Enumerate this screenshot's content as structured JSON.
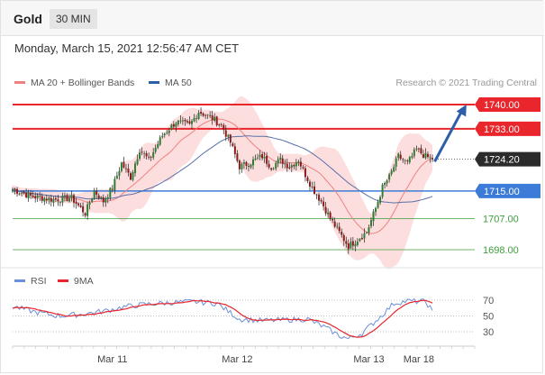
{
  "header": {
    "title": "Gold",
    "timeframe": "30 MIN"
  },
  "datetime": "Monday, March 15, 2021 12:56:47 AM CET",
  "colors": {
    "resistance": "#e8262b",
    "support": "#3d7bd8",
    "target": "#3e9e3e",
    "price_tag": "#2b2b2b",
    "ma20": "#f08080",
    "bollinger": "#fbd3d3",
    "ma50": "#5a6fa8",
    "up_candle": "#2e7d32",
    "down_candle": "#8b1a1a",
    "rsi": "#6b8fd8",
    "rsi_ma": "#e8262b",
    "arrow": "#2d5fa8"
  },
  "chart_data": [
    {
      "type": "candlestick",
      "legend": [
        {
          "name": "MA 20 + Bollinger Bands",
          "color": "#f08080"
        },
        {
          "name": "MA 50",
          "color": "#2d5fa8"
        }
      ],
      "credit": "Research © 2021 Trading Central",
      "x_ticks": [
        {
          "label": "Mar 11",
          "index": 44
        },
        {
          "label": "Mar 12",
          "index": 99
        },
        {
          "label": "Mar 13",
          "index": 157
        },
        {
          "label": "Mar 18",
          "index": 179
        }
      ],
      "ylim": [
        1690,
        1748
      ],
      "levels": [
        {
          "value": 1740.0,
          "label": "1740.00",
          "kind": "resistance"
        },
        {
          "value": 1733.0,
          "label": "1733.00",
          "kind": "resistance"
        },
        {
          "value": 1724.2,
          "label": "1724.20",
          "kind": "current"
        },
        {
          "value": 1715.0,
          "label": "1715.00",
          "kind": "support"
        },
        {
          "value": 1707.0,
          "label": "1707.00",
          "kind": "target"
        },
        {
          "value": 1698.0,
          "label": "1698.00",
          "kind": "target"
        }
      ],
      "close_anchors": [
        [
          0,
          1715.5
        ],
        [
          8,
          1713.5
        ],
        [
          18,
          1712.5
        ],
        [
          26,
          1713
        ],
        [
          32,
          1708.5
        ],
        [
          36,
          1715
        ],
        [
          40,
          1712
        ],
        [
          44,
          1716
        ],
        [
          48,
          1723
        ],
        [
          52,
          1719
        ],
        [
          56,
          1727
        ],
        [
          60,
          1724
        ],
        [
          66,
          1731
        ],
        [
          72,
          1735
        ],
        [
          78,
          1734
        ],
        [
          82,
          1738
        ],
        [
          88,
          1736
        ],
        [
          92,
          1734
        ],
        [
          96,
          1729
        ],
        [
          100,
          1722
        ],
        [
          104,
          1723
        ],
        [
          110,
          1725
        ],
        [
          114,
          1722
        ],
        [
          118,
          1724
        ],
        [
          122,
          1722
        ],
        [
          126,
          1724
        ],
        [
          128,
          1721
        ],
        [
          132,
          1716
        ],
        [
          136,
          1712
        ],
        [
          140,
          1707
        ],
        [
          144,
          1703
        ],
        [
          148,
          1699
        ],
        [
          152,
          1701
        ],
        [
          156,
          1703
        ],
        [
          160,
          1710
        ],
        [
          163,
          1716
        ],
        [
          166,
          1719
        ],
        [
          170,
          1725
        ],
        [
          174,
          1723
        ],
        [
          178,
          1727
        ],
        [
          182,
          1725
        ],
        [
          185,
          1724.2
        ]
      ],
      "projection": {
        "from": [
          186,
          1723.5
        ],
        "to": [
          200,
          1740
        ]
      }
    },
    {
      "type": "line",
      "legend": [
        {
          "name": "RSI",
          "color": "#6b8fd8"
        },
        {
          "name": "9MA",
          "color": "#e8262b"
        }
      ],
      "y_ticks": [
        70,
        50,
        30
      ],
      "ylim": [
        15,
        80
      ],
      "rsi_anchors": [
        [
          0,
          62
        ],
        [
          10,
          55
        ],
        [
          20,
          50
        ],
        [
          30,
          52
        ],
        [
          40,
          56
        ],
        [
          50,
          62
        ],
        [
          60,
          65
        ],
        [
          70,
          67
        ],
        [
          80,
          68
        ],
        [
          90,
          66
        ],
        [
          100,
          46
        ],
        [
          110,
          44
        ],
        [
          120,
          45
        ],
        [
          130,
          46
        ],
        [
          138,
          35
        ],
        [
          144,
          25
        ],
        [
          148,
          21
        ],
        [
          154,
          28
        ],
        [
          162,
          49
        ],
        [
          168,
          66
        ],
        [
          174,
          69
        ],
        [
          182,
          68
        ],
        [
          185,
          57
        ]
      ]
    }
  ]
}
